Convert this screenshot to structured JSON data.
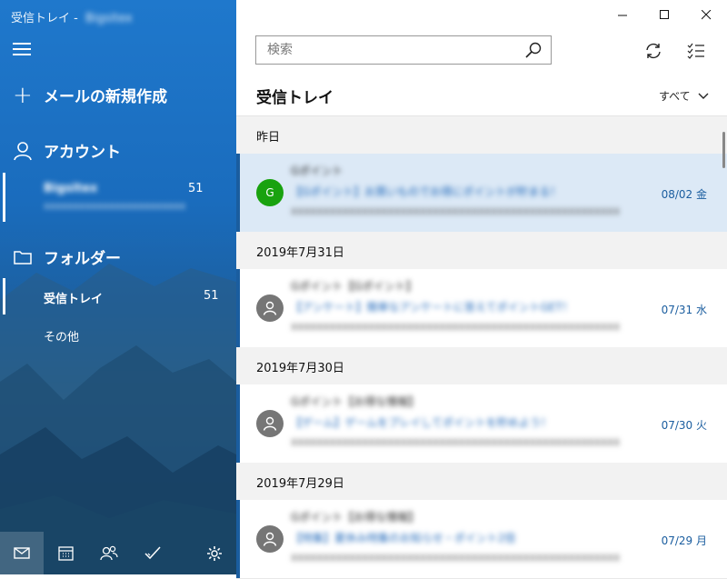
{
  "window": {
    "title": "受信トレイ - ",
    "account_blurred": "Bigsitex"
  },
  "sidebar": {
    "new_mail_label": "メールの新規作成",
    "accounts_label": "アカウント",
    "account": {
      "name": "Bigsitex",
      "email": "xxxxxxxxxxxxxxxxxxxxxxxx",
      "count": "51"
    },
    "folders_label": "フォルダー",
    "folders": [
      {
        "label": "受信トレイ",
        "count": "51"
      },
      {
        "label": "その他",
        "count": ""
      }
    ]
  },
  "search": {
    "placeholder": "検索"
  },
  "list": {
    "title": "受信トレイ",
    "filter_label": "すべて",
    "groups": [
      {
        "date_label": "昨日",
        "messages": [
          {
            "avatar": "G",
            "avatar_color": "#19a20f",
            "sender": "Gポイント",
            "subject": "【Gポイント】お買いものでお得にポイントが貯まる！",
            "preview": "xxxxxxxxxxxxxxxxxxxxxxxxxxxxxxxxxxxxxxxxxxxxxxxxxxx",
            "date": "08/02 金",
            "selected": true
          }
        ]
      },
      {
        "date_label": "2019年7月31日",
        "messages": [
          {
            "avatar": "",
            "avatar_color": "#767676",
            "sender": "Gポイント【Gポイント】",
            "subject": "【アンケート】簡単なアンケートに答えてポイントGET！",
            "preview": "xxxxxxxxxxxxxxxxxxxxxxxxxxxxxxxxxxxxxxxxxxxxxxxxxxx",
            "date": "07/31 水",
            "selected": false
          }
        ]
      },
      {
        "date_label": "2019年7月30日",
        "messages": [
          {
            "avatar": "",
            "avatar_color": "#767676",
            "sender": "Gポイント【お得な情報】",
            "subject": "【ゲーム】ゲームをプレイしてポイントを貯めよう！",
            "preview": "xxxxxxxxxxxxxxxxxxxxxxxxxxxxxxxxxxxxxxxxxxxxxxxxxxx",
            "date": "07/30 火",
            "selected": false
          }
        ]
      },
      {
        "date_label": "2019年7月29日",
        "messages": [
          {
            "avatar": "",
            "avatar_color": "#767676",
            "sender": "Gポイント【お得な情報】",
            "subject": "【特集】夏休み特集のお知らせ・ポイント2倍",
            "preview": "xxxxxxxxxxxxxxxxxxxxxxxxxxxxxxxxxxxxxxxxxxxxxxxxxxx",
            "date": "07/29 月",
            "selected": false
          }
        ]
      }
    ]
  },
  "colors": {
    "accent": "#1a5d9f",
    "selected_bg": "#dce9f6",
    "sidebar": "#1f78cc"
  }
}
